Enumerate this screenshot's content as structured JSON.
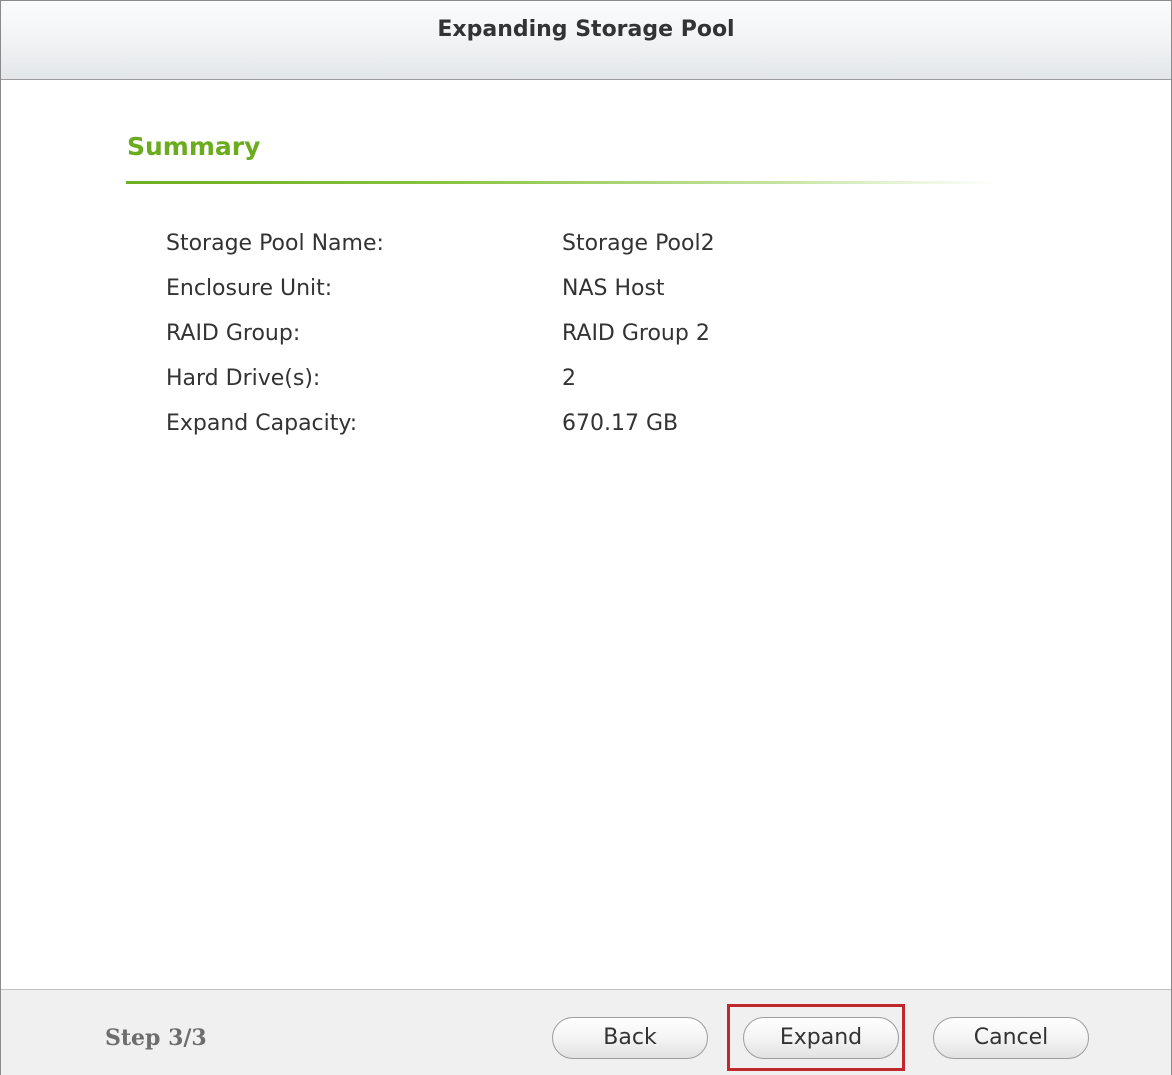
{
  "dialog": {
    "title": "Expanding Storage Pool"
  },
  "summary": {
    "heading": "Summary",
    "rows": [
      {
        "label": "Storage Pool Name:",
        "value": "Storage Pool2"
      },
      {
        "label": "Enclosure Unit:",
        "value": "NAS Host"
      },
      {
        "label": "RAID Group:",
        "value": "RAID Group 2"
      },
      {
        "label": "Hard Drive(s):",
        "value": "2"
      },
      {
        "label": "Expand Capacity:",
        "value": "670.17 GB"
      }
    ]
  },
  "footer": {
    "step": "Step 3/3",
    "back_label": "Back",
    "expand_label": "Expand",
    "cancel_label": "Cancel"
  },
  "colors": {
    "accent_green": "#6bab1e",
    "highlight_red": "#c0282d"
  }
}
